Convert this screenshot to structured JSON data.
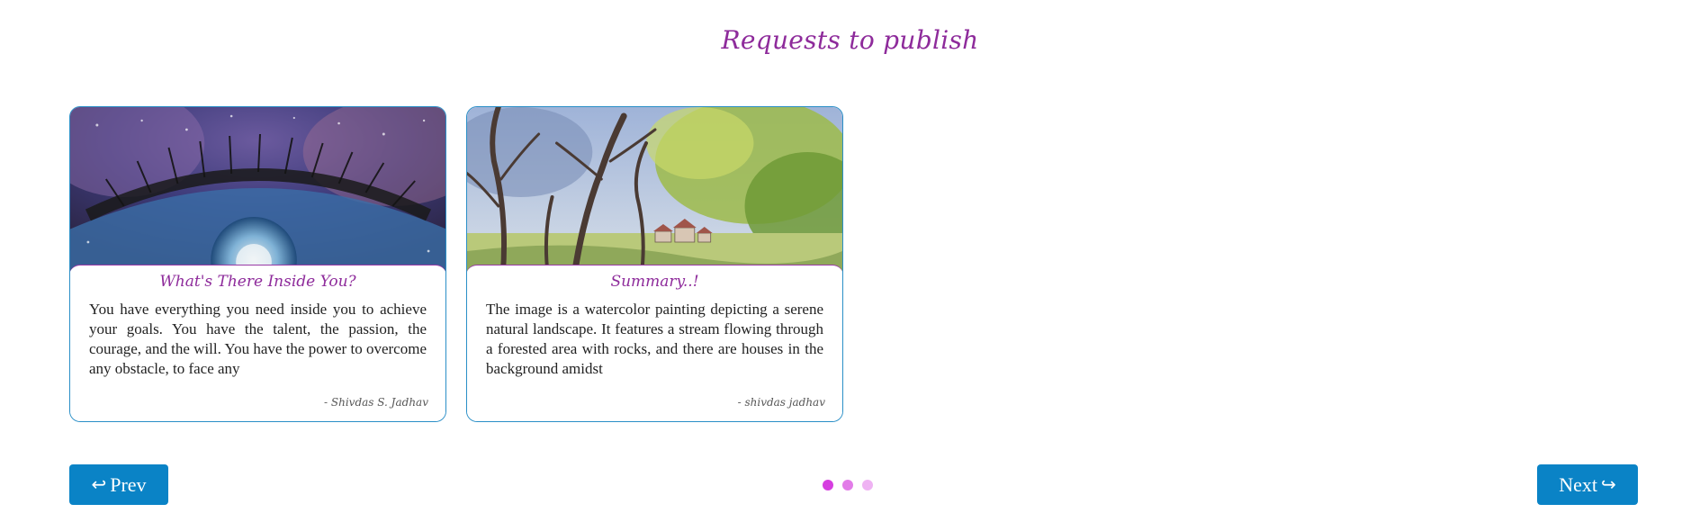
{
  "header": {
    "title": "Requests to publish"
  },
  "cards": [
    {
      "title": "What's There Inside You?",
      "text": "You have everything you need inside you to achieve your goals. You have the talent, the passion, the courage, and the will. You have the power to overcome any obstacle, to face any",
      "author": "- Shivdas S. Jadhav",
      "image_subject": "watercolor-eye-painting"
    },
    {
      "title": "Summary..!",
      "text": "The image is a watercolor painting depicting a serene natural landscape. It features a stream flowing through a forested area with rocks, and there are houses in the background amidst",
      "author": "- shivdas jadhav",
      "image_subject": "watercolor-forest-landscape"
    }
  ],
  "navigation": {
    "prev_label": "Prev",
    "prev_icon": "↩",
    "next_label": "Next",
    "next_icon": "↪",
    "pagination_dots": 3,
    "active_dot": 0
  },
  "colors": {
    "title": "#8e2b9b",
    "card_border": "#2a8fc7",
    "button": "#0a83c6",
    "dot_active": "#d63ee0",
    "dot_mid": "#e27ce8",
    "dot_light": "#efb3f3"
  }
}
